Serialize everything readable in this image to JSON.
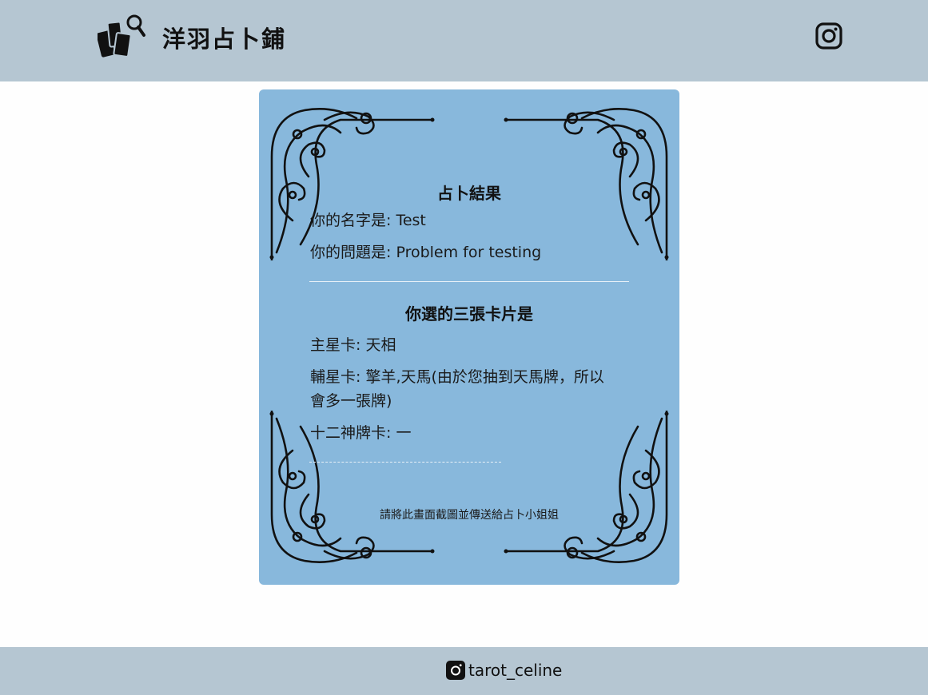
{
  "header": {
    "logo_icon": "tarot-cards-magnifier-icon",
    "title": "洋羽占卜鋪",
    "instagram_icon": "instagram-icon"
  },
  "result": {
    "title": "占卜結果",
    "name_line": "你的名字是: Test",
    "question_line": "你的問題是: Problem for testing"
  },
  "cards": {
    "title": "你選的三張卡片是",
    "main_star": "主星卡: 天相",
    "aux_star_line1": "輔星卡: 擎羊,天馬(由於您抽到天馬牌，所以",
    "aux_star_line2": "會多一張牌)",
    "twelve_gods": "十二神牌卡: 一"
  },
  "footnote": "請將此畫面截圖並傳送給占卜小姐姐",
  "footer": {
    "instagram_icon": "instagram-icon",
    "handle": "tarot_celine"
  },
  "colors": {
    "header_bg": "#b5c6d2",
    "card_bg": "#88b8dc",
    "page_bg": "#fefefe"
  }
}
